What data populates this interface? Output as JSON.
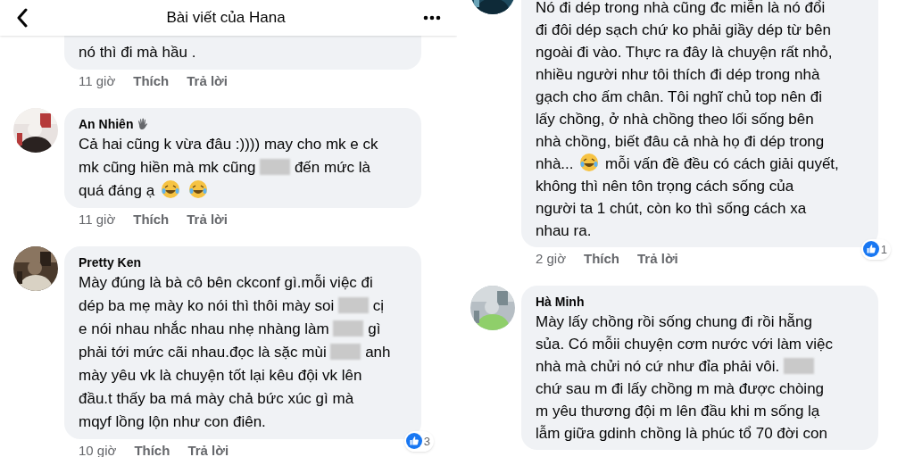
{
  "panels": [
    {
      "header": {
        "title": "Bài viết của Hana"
      },
      "comments": [
        {
          "cut_top": true,
          "lines": [
            [
              {
                "kind": "text",
                "text": "nó thì đi mà hầu ."
              }
            ]
          ],
          "time": "11 giờ",
          "like": "Thích",
          "reply": "Trả lời"
        },
        {
          "avatar": {
            "kind": "picture"
          },
          "name": "An Nhiên",
          "badge": true,
          "lines": [
            [
              {
                "kind": "text",
                "text": "Cả hai cũng k vừa đâu :)))) may cho mk e ck"
              }
            ],
            [
              {
                "kind": "text",
                "text": "mk cũng hiền mà mk cũng"
              },
              {
                "kind": "blur"
              },
              {
                "kind": "text",
                "text": "đến mức là"
              }
            ],
            [
              {
                "kind": "text",
                "text": "quá đáng ạ"
              },
              {
                "kind": "emoji"
              },
              {
                "kind": "emoji"
              }
            ]
          ],
          "time": "11 giờ",
          "like": "Thích",
          "reply": "Trả lời"
        },
        {
          "avatar": {
            "kind": "picture"
          },
          "name": "Pretty Ken",
          "lines": [
            [
              {
                "kind": "text",
                "text": "Mày đúng là bà cô bên ckconf gì.mỗi việc đi"
              }
            ],
            [
              {
                "kind": "text",
                "text": "dép ba mẹ mày ko nói thì thôi mày soi"
              },
              {
                "kind": "blur"
              },
              {
                "kind": "text",
                "text": "cị"
              }
            ],
            [
              {
                "kind": "text",
                "text": "e nói nhau nhắc nhau nhẹ nhàng làm"
              },
              {
                "kind": "blur"
              },
              {
                "kind": "text",
                "text": "gì"
              }
            ],
            [
              {
                "kind": "text",
                "text": "phải tới mức cãi nhau.đọc là sặc mùi"
              },
              {
                "kind": "blur"
              },
              {
                "kind": "text",
                "text": "anh"
              }
            ],
            [
              {
                "kind": "text",
                "text": "mày yêu vk là chuyện tốt lại kêu đội vk lên"
              }
            ],
            [
              {
                "kind": "text",
                "text": "đầu.t thấy ba má mày chả bức xúc gì mà"
              }
            ],
            [
              {
                "kind": "text",
                "text": "mqyf lồng lộn như con điên."
              }
            ]
          ],
          "time": "10 giờ",
          "like": "Thích",
          "reply": "Trả lời",
          "reactions": "3"
        }
      ]
    },
    {
      "comments": [
        {
          "cut_top": true,
          "avatar": {
            "kind": "picture"
          },
          "lines": [
            [
              {
                "kind": "text",
                "text": "Nó đi dép trong nhà cũng đc miễn là nó đổi"
              }
            ],
            [
              {
                "kind": "text",
                "text": "đi đôi dép sạch chứ ko phải giầy dép từ bên"
              }
            ],
            [
              {
                "kind": "text",
                "text": "ngoài đi vào. Thực ra đây là chuyện rất nhỏ,"
              }
            ],
            [
              {
                "kind": "text",
                "text": "nhiều người như tôi thích đi dép trong nhà"
              }
            ],
            [
              {
                "kind": "text",
                "text": "gạch cho ấm chân. Tôi nghĩ chủ top nên đi"
              }
            ],
            [
              {
                "kind": "text",
                "text": "lấy chồng, ở nhà chồng theo lối sống bên"
              }
            ],
            [
              {
                "kind": "text",
                "text": "nhà chồng, biết đâu cả nhà họ đi dép trong"
              }
            ],
            [
              {
                "kind": "text",
                "text": "nhà..."
              },
              {
                "kind": "emoji"
              },
              {
                "kind": "text",
                "text": "mỗi vấn đề đều có cách giải quyết,"
              }
            ],
            [
              {
                "kind": "text",
                "text": "không thì nên tôn trọng cách sống của"
              }
            ],
            [
              {
                "kind": "text",
                "text": "người ta 1 chút, còn ko thì sống cách xa"
              }
            ],
            [
              {
                "kind": "text",
                "text": "nhau ra."
              }
            ]
          ],
          "time": "2 giờ",
          "like": "Thích",
          "reply": "Trả lời",
          "reactions": "1"
        },
        {
          "avatar": {
            "kind": "picture"
          },
          "name": "Hà Minh",
          "lines": [
            [
              {
                "kind": "text",
                "text": "Mày lấy chồng rồi sống chung đi rồi hẵng"
              }
            ],
            [
              {
                "kind": "text",
                "text": "sủa. Có mỗii chuyện cơm nước với làm việc"
              }
            ],
            [
              {
                "kind": "text",
                "text": "nhà mà chửi nó cứ như đỉa phải vôi."
              },
              {
                "kind": "blur"
              }
            ],
            [
              {
                "kind": "text",
                "text": "chứ sau m đi lấy chồng m mà được chòing"
              }
            ],
            [
              {
                "kind": "text",
                "text": "m yêu thương đội m lên đầu khi m sống lạ"
              }
            ],
            [
              {
                "kind": "text",
                "text": "lẫm giữa gdinh chồng là phúc tổ 70 đời con"
              }
            ]
          ]
        }
      ]
    }
  ]
}
